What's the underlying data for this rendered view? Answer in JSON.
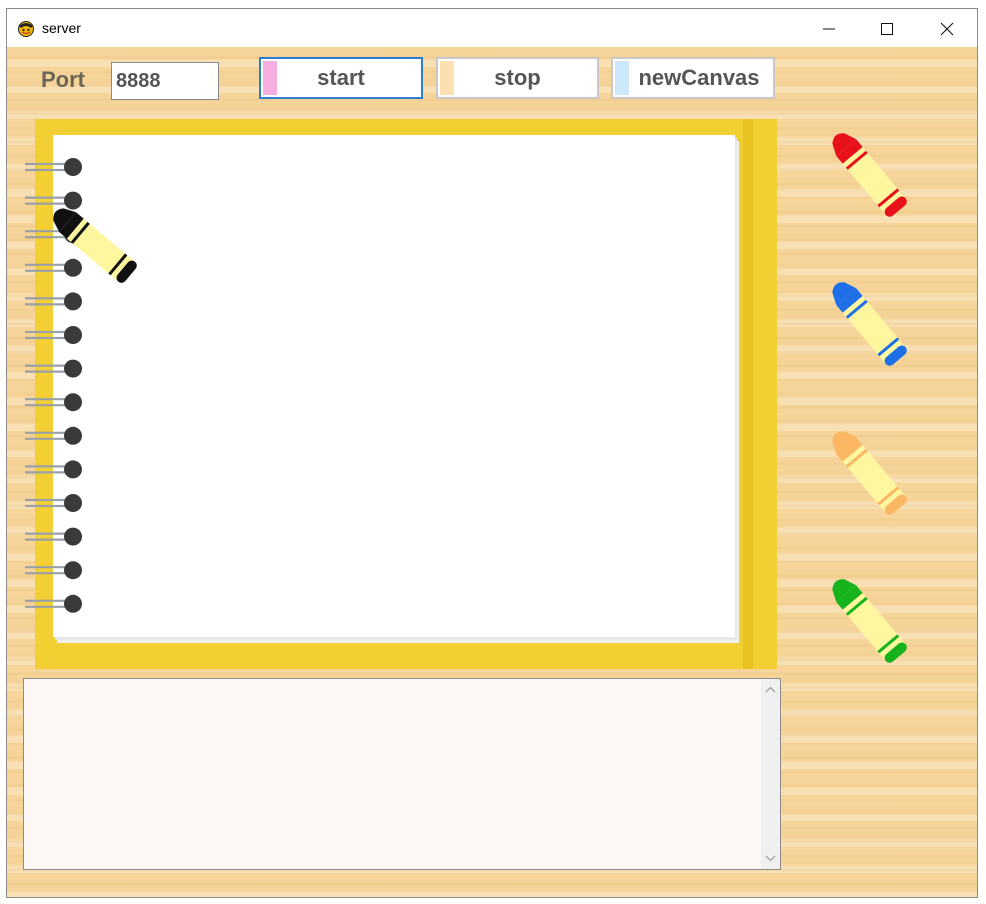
{
  "window": {
    "title": "server"
  },
  "toolbar": {
    "port_label": "Port",
    "port_value": "8888",
    "start_label": "start",
    "stop_label": "stop",
    "newcanvas_label": "newCanvas"
  },
  "colors": {
    "start_swatch": "#f6aee0",
    "stop_swatch": "#fde0b2",
    "newcanvas_swatch": "#cde8fa",
    "notebook_cover": "#f2cf33",
    "wood_background": "#f6d59b"
  },
  "crayons": [
    {
      "name": "black-crayon",
      "color": "#111111"
    },
    {
      "name": "red-crayon",
      "color": "#e8101a"
    },
    {
      "name": "blue-crayon",
      "color": "#1f6fe8"
    },
    {
      "name": "orange-crayon",
      "color": "#fbb763"
    },
    {
      "name": "green-crayon",
      "color": "#16b31c"
    }
  ],
  "log": {
    "text": ""
  }
}
